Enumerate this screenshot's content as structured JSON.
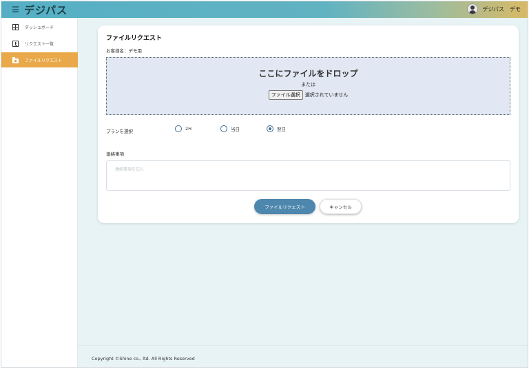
{
  "app": {
    "title": "デジパス",
    "user_name": "デジパス　デモ"
  },
  "sidebar": {
    "items": [
      {
        "label": "ダッシュボード",
        "icon": "grid-icon",
        "active": false
      },
      {
        "label": "リクエスト一覧",
        "icon": "list-icon",
        "active": false
      },
      {
        "label": "ファイルリクエスト",
        "icon": "folder-icon",
        "active": true
      }
    ]
  },
  "form": {
    "title": "ファイルリクエスト",
    "customer_line": "お客様名：デモ用",
    "dropzone": {
      "title": "ここにファイルをドロップ",
      "or_text": "または",
      "file_button": "ファイル選択",
      "file_status": "選択されていません"
    },
    "plan": {
      "label": "プランを選択",
      "options": [
        {
          "label": "2H",
          "checked": false
        },
        {
          "label": "当日",
          "checked": false
        },
        {
          "label": "翌日",
          "checked": true
        }
      ]
    },
    "notes": {
      "label": "連絡事項",
      "placeholder": "連絡事項を記入",
      "value": ""
    },
    "submit_label": "ファイルリクエスト",
    "cancel_label": "キャンセル"
  },
  "footer": {
    "copyright": "Copyright ©Shine co., ltd. All Rights Reserved"
  },
  "colors": {
    "accent": "#e9a94a",
    "primary_button": "#4e87ad",
    "header_start": "#55afc4",
    "header_end": "#d9b964",
    "dropzone_bg": "#e1e8f3",
    "main_bg": "#e8f3f5"
  }
}
